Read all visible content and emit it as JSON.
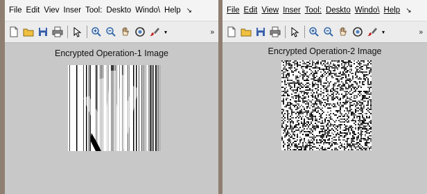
{
  "left_window": {
    "menu": [
      "File",
      "Edit",
      "View",
      "Insert",
      "Tools",
      "Desktop",
      "Window",
      "Help"
    ],
    "menu_display": [
      "File",
      "Edit",
      "Viev",
      "Inser",
      "Tool:",
      "Deskto",
      "Windo\\",
      "Help"
    ],
    "figure_title": "Encrypted Operation-1 Image"
  },
  "right_window": {
    "menu_display": [
      "File",
      "Edit",
      "View",
      "Inser",
      "Tool:",
      "Deskto",
      "Windo\\",
      "Help"
    ],
    "figure_title": "Encrypted Operation-2 Image"
  },
  "toolbar_icons": [
    "new-file-icon",
    "open-folder-icon",
    "save-icon",
    "print-icon",
    "pointer-icon",
    "zoom-in-icon",
    "zoom-out-icon",
    "pan-hand-icon",
    "rotate-3d-icon",
    "brush-icon",
    "dropdown-icon"
  ],
  "colors": {
    "window_bg": "#c8c8c8",
    "menubar_bg": "#f4f4f4",
    "toolbar_bg": "#ececec",
    "desktop_bg": "#8f7f72"
  }
}
